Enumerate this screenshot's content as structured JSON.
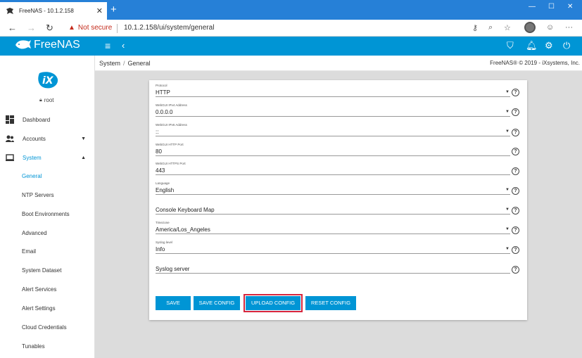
{
  "browser": {
    "tab_title": "FreeNAS - 10.1.2.158",
    "security_label": "Not secure",
    "url": "10.1.2.158/ui/system/general"
  },
  "app": {
    "brand": "FreeNAS",
    "accent_color": "#0095d5"
  },
  "sidebar": {
    "username": "root",
    "items": [
      {
        "label": "Dashboard",
        "icon": "dashboard-icon"
      },
      {
        "label": "Accounts",
        "icon": "accounts-icon"
      },
      {
        "label": "System",
        "icon": "system-icon"
      }
    ],
    "sub_items": [
      "General",
      "NTP Servers",
      "Boot Environments",
      "Advanced",
      "Email",
      "System Dataset",
      "Alert Services",
      "Alert Settings",
      "Cloud Credentials",
      "Tunables"
    ]
  },
  "breadcrumb": {
    "parent": "System",
    "separator": "/",
    "current": "General",
    "copyright": "FreeNAS® © 2019 - iXsystems, Inc."
  },
  "form": {
    "fields": [
      {
        "label": "Protocol",
        "value": "HTTP",
        "type": "select"
      },
      {
        "label": "WebGUI IPv4 Address",
        "value": "0.0.0.0",
        "type": "select"
      },
      {
        "label": "WebGUI IPv6 Address",
        "value": "::",
        "type": "select"
      },
      {
        "label": "WebGUI HTTP Port",
        "value": "80",
        "type": "input"
      },
      {
        "label": "WebGUI HTTPS Port",
        "value": "443",
        "type": "input"
      },
      {
        "label": "Language",
        "value": "English",
        "type": "select"
      },
      {
        "label": "",
        "value": "Console Keyboard Map",
        "type": "select"
      },
      {
        "label": "Timezone",
        "value": "America/Los_Angeles",
        "type": "select"
      },
      {
        "label": "Syslog level",
        "value": "Info",
        "type": "select"
      },
      {
        "label": "",
        "value": "Syslog server",
        "type": "input"
      }
    ],
    "buttons": {
      "save": "SAVE",
      "save_config": "SAVE CONFIG",
      "upload_config": "UPLOAD CONFIG",
      "reset_config": "RESET CONFIG"
    }
  }
}
